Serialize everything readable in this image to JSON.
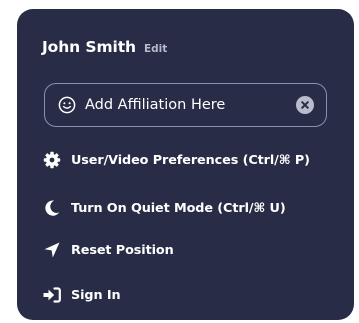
{
  "profile": {
    "name": "John Smith",
    "edit_label": "Edit"
  },
  "affiliation": {
    "placeholder": "Add Affiliation Here",
    "leading_icon": "smiley-icon",
    "trailing_icon": "clear-circle-icon"
  },
  "menu": {
    "items": [
      {
        "label": "User/Video Preferences (Ctrl/⌘ P)",
        "icon": "gear-icon"
      },
      {
        "label": "Turn On Quiet Mode (Ctrl/⌘ U)",
        "icon": "moon-icon"
      },
      {
        "label": "Reset Position",
        "icon": "location-arrow-icon"
      },
      {
        "label": "Sign In",
        "icon": "sign-in-icon"
      }
    ]
  },
  "colors": {
    "panel_background": "#282c46",
    "text": "#ffffff",
    "muted": "#b7bacd",
    "input_border": "#8b90b0"
  }
}
